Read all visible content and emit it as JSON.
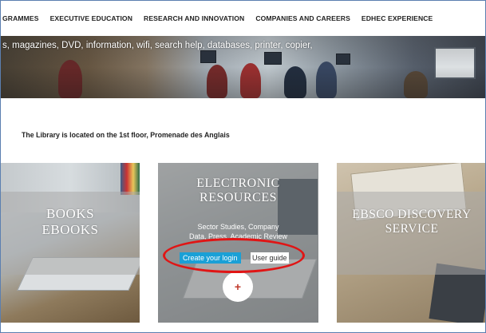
{
  "nav": {
    "items": [
      "GRAMMES",
      "EXECUTIVE EDUCATION",
      "RESEARCH AND INNOVATION",
      "COMPANIES AND CAREERS",
      "EDHEC EXPERIENCE"
    ]
  },
  "hero": {
    "text": "s, magazines, DVD, information, wifi, search help, databases, printer, copier,"
  },
  "location": "The Library is located on the 1st floor, Promenade des Anglais",
  "cards": {
    "books": {
      "title_line1": "BOOKS",
      "title_line2": "EBOOKS"
    },
    "electronic": {
      "title_line1": "ELECTRONIC",
      "title_line2": "RESOURCES",
      "desc_line1": "Sector Studies, Company",
      "desc_line2": "Data, Press, Academic Review",
      "login_label": "Create your login",
      "guide_label": "User guide",
      "plus_label": "+"
    },
    "ebsco": {
      "title_line1": "EBSCO DISCOVERY",
      "title_line2": "SERVICE"
    }
  },
  "colors": {
    "login_button": "#1aa0d6",
    "highlight": "#e01515",
    "plus": "#c0392b"
  }
}
